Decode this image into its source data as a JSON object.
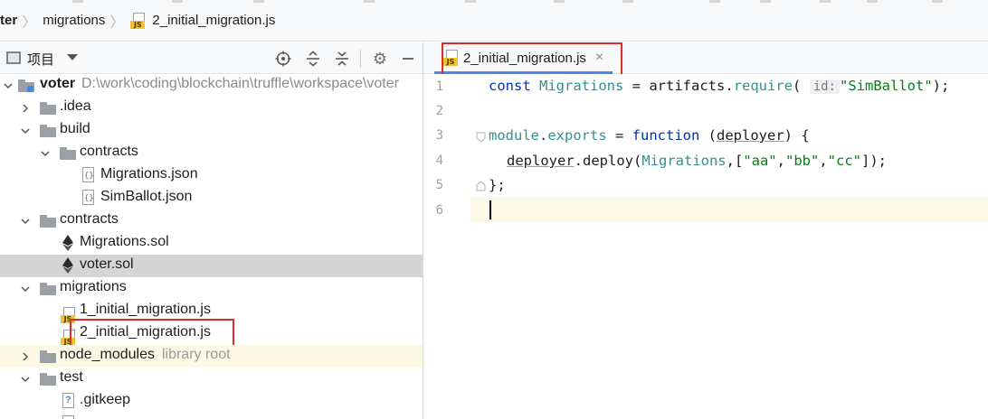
{
  "breadcrumb": {
    "items": [
      "ter",
      "migrations",
      "2_initial_migration.js"
    ]
  },
  "project_panel": {
    "title": "项目",
    "tool_icons": [
      "locate-icon",
      "expand-all-icon",
      "collapse-all-icon",
      "gear-icon",
      "minimize-icon"
    ]
  },
  "tree": {
    "root": {
      "label": "voter",
      "path": "D:\\work\\coding\\blockchain\\truffle\\workspace\\voter"
    },
    "items": [
      {
        "label": ".idea",
        "type": "folder",
        "expanded": false
      },
      {
        "label": "build",
        "type": "folder",
        "expanded": true
      },
      {
        "label": "contracts",
        "type": "folder",
        "expanded": true
      },
      {
        "label": "Migrations.json",
        "type": "json"
      },
      {
        "label": "SimBallot.json",
        "type": "json"
      },
      {
        "label": "contracts",
        "type": "folder",
        "expanded": true
      },
      {
        "label": "Migrations.sol",
        "type": "sol"
      },
      {
        "label": "voter.sol",
        "type": "sol",
        "selected": true
      },
      {
        "label": "migrations",
        "type": "folder",
        "expanded": true
      },
      {
        "label": "1_initial_migration.js",
        "type": "js"
      },
      {
        "label": "2_initial_migration.js",
        "type": "js",
        "highlighted": true
      },
      {
        "label": "node_modules",
        "type": "folder",
        "expanded": false,
        "hint": "library root"
      },
      {
        "label": "test",
        "type": "folder",
        "expanded": true
      },
      {
        "label": ".gitkeep",
        "type": "file"
      }
    ]
  },
  "editor": {
    "tab": {
      "label": "2_initial_migration.js",
      "close": "×"
    },
    "line_numbers": [
      "1",
      "2",
      "3",
      "4",
      "5",
      "6"
    ],
    "lines": {
      "l1": {
        "kw": "const",
        "id": "Migrations",
        "eq": " = ",
        "obj": "artifacts",
        "dot": ".",
        "method": "require",
        "open": "(",
        "hint": "id:",
        "str": "\"SimBallot\"",
        "close": ");"
      },
      "l3": {
        "a": "module",
        "b": ".",
        "c": "exports",
        "d": " = ",
        "kw": "function",
        "e": " (",
        "param": "deployer",
        "f": ") {"
      },
      "l4": {
        "a": "deployer",
        "b": ".deploy(",
        "id": "Migrations",
        "c": ",[",
        "s1": "\"aa\"",
        "c1": ",",
        "s2": "\"bb\"",
        "c2": ",",
        "s3": "\"cc\"",
        "d": "]);"
      },
      "l5": {
        "a": "};"
      }
    }
  },
  "colors": {
    "highlight_box": "#e02b2b",
    "tab_underline": "#4a86e8",
    "keyword": "#0033b3",
    "identifier": "#378e8e",
    "string": "#067d17"
  }
}
